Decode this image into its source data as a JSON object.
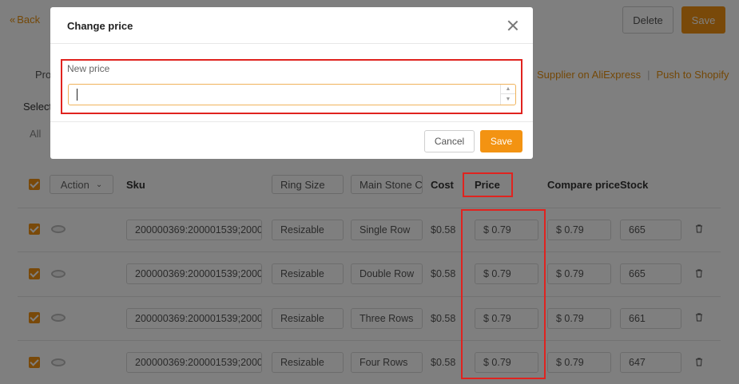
{
  "header": {
    "back_label": "Back",
    "delete_label": "Delete",
    "save_label": "Save"
  },
  "page": {
    "tab_partial": "Pro",
    "links": [
      "Supplier on AliExpress",
      "Push to Shopify"
    ],
    "link_separator": "|",
    "select_label": "Select",
    "all_label": "All"
  },
  "table": {
    "action_label": "Action",
    "columns": {
      "sku": "Sku",
      "ring_size": "Ring Size",
      "main_stone": "Main Stone C",
      "cost": "Cost",
      "price": "Price",
      "compare_price": "Compare price",
      "stock": "Stock"
    },
    "rows": [
      {
        "sku": "200000369:200001539;20000",
        "ring_size": "Resizable",
        "main_stone": "Single Row",
        "cost": "$0.58",
        "price": "$ 0.79",
        "compare_price": "$ 0.79",
        "stock": "665"
      },
      {
        "sku": "200000369:200001539;20000",
        "ring_size": "Resizable",
        "main_stone": "Double Row",
        "cost": "$0.58",
        "price": "$ 0.79",
        "compare_price": "$ 0.79",
        "stock": "665"
      },
      {
        "sku": "200000369:200001539;20000",
        "ring_size": "Resizable",
        "main_stone": "Three Rows",
        "cost": "$0.58",
        "price": "$ 0.79",
        "compare_price": "$ 0.79",
        "stock": "661"
      },
      {
        "sku": "200000369:200001539;20000",
        "ring_size": "Resizable",
        "main_stone": "Four Rows",
        "cost": "$0.58",
        "price": "$ 0.79",
        "compare_price": "$ 0.79",
        "stock": "647"
      }
    ]
  },
  "modal": {
    "title": "Change price",
    "field_label": "New price",
    "input_value": "",
    "cancel_label": "Cancel",
    "save_label": "Save"
  },
  "colors": {
    "accent": "#f39312",
    "highlight": "#e0231f"
  }
}
